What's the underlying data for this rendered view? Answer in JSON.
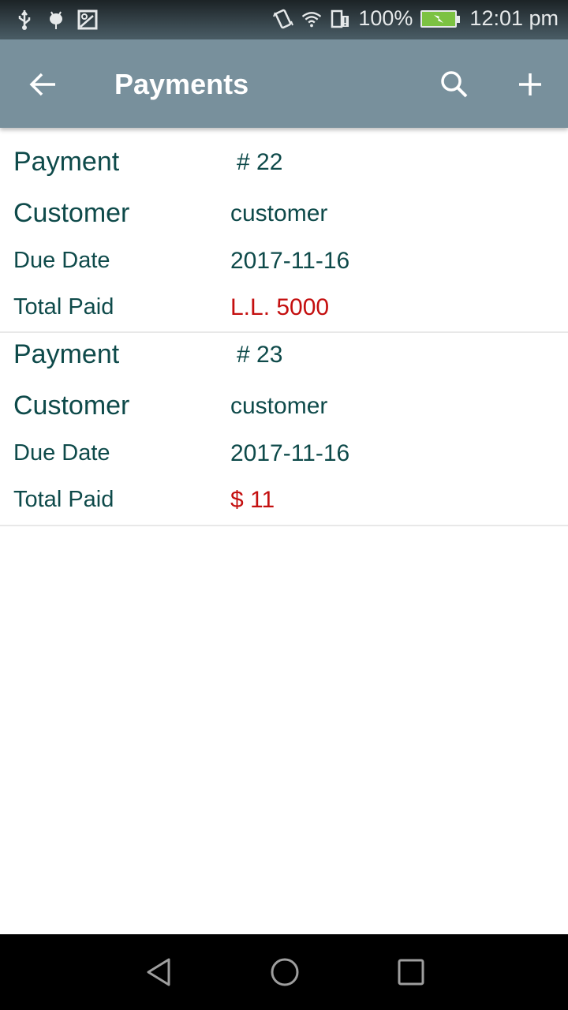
{
  "status_bar": {
    "left_icons": [
      "usb-icon",
      "android-debug-icon",
      "image-icon"
    ],
    "right_icons": [
      "vibrate-icon",
      "wifi-icon",
      "sim-alert-icon"
    ],
    "battery_percent": "100%",
    "battery_level": 1.0,
    "battery_charging": true,
    "time": "12:01 pm",
    "colors": {
      "battery_fill": "#7cc242"
    }
  },
  "app_bar": {
    "title": "Payments",
    "back_icon": "arrow-left-icon",
    "actions": [
      {
        "name": "search",
        "icon": "search-icon"
      },
      {
        "name": "add",
        "icon": "plus-icon"
      }
    ],
    "background": "#78909c"
  },
  "payments": [
    {
      "payment_label": "Payment",
      "payment_value": "# 22",
      "customer_label": "Customer",
      "customer_value": "customer",
      "due_date_label": "Due Date",
      "due_date_value": "2017-11-16",
      "total_paid_label": "Total Paid",
      "total_paid_value": "L.L. 5000"
    },
    {
      "payment_label": "Payment",
      "payment_value": "# 23",
      "customer_label": "Customer",
      "customer_value": "customer",
      "due_date_label": "Due Date",
      "due_date_value": "2017-11-16",
      "total_paid_label": "Total Paid",
      "total_paid_value": "$ 11"
    }
  ],
  "colors": {
    "text": "#0e4a4a",
    "amount": "#c40f0f"
  },
  "nav_bar": {
    "buttons": [
      "back-triangle-icon",
      "home-circle-icon",
      "recents-square-icon"
    ]
  }
}
